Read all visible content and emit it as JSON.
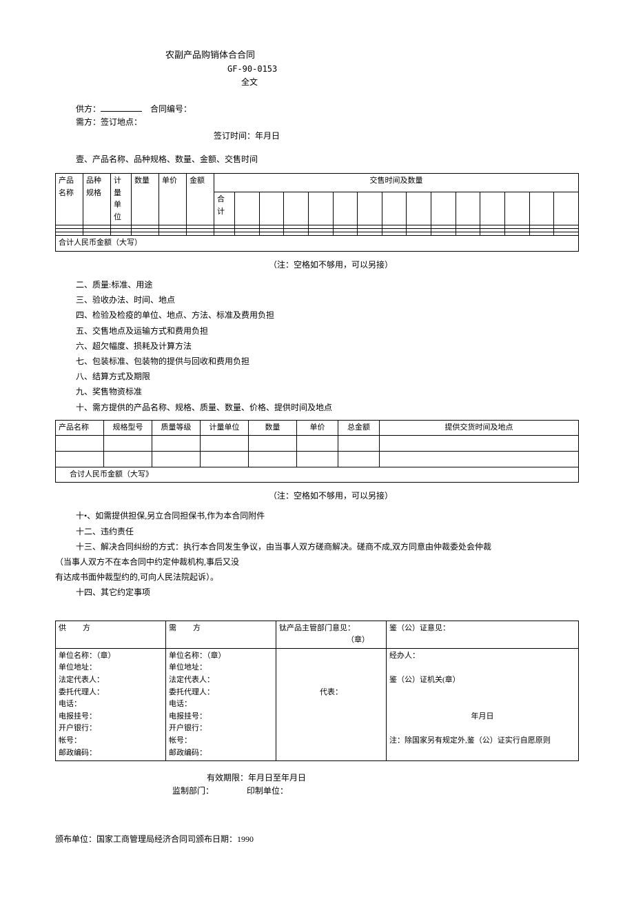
{
  "header": {
    "title": "农副产品购销体合合同",
    "code": "GF-90-0153",
    "fulltext": "全文"
  },
  "parties": {
    "supplier_label": "供方：",
    "contract_no_label": "合同编号：",
    "buyer_label": "需方：",
    "sign_place_label": "签订地点：",
    "sign_time_label": "签订时间：年月日"
  },
  "section1": {
    "title": "壹、产品名称、品种规格、数量、金额、交售时间"
  },
  "table1": {
    "h1": "产品名称",
    "h2": "品种规格",
    "h3": "计量单位",
    "h4": "数量",
    "h5": "单价",
    "h6": "金额",
    "h7": "交售时间及数量",
    "h8": "合计",
    "total": "合计人民币金额（大写）"
  },
  "note": "（注：空格如不够用，可以另接）",
  "terms": {
    "t2": "二、质量:标准、用途",
    "t3": "三、验收办法、时间、地点",
    "t4": "四、检验及检疫的单位、地点、方法、标准及费用负担",
    "t5": "五、交售地点及运输方式和费用负担",
    "t6": "六、超欠幅度、损耗及计算方法",
    "t7": "七、包装标准、包装物的提供与回收和费用负担",
    "t8": "八、结算方式及期限",
    "t9": "九、奖售物资标准",
    "t10": "十、需方提供的产品名称、规格、质量、数量、价格、提供时间及地点"
  },
  "table2": {
    "h1": "产品名称",
    "h2": "规格型号",
    "h3": "质量等级",
    "h4": "计量单位",
    "h5": "数量",
    "h6": "单价",
    "h7": "总金额",
    "h8": "提供交货时间及地点",
    "total": "合讨人民币金额（大写》"
  },
  "terms2": {
    "t11": "十•、如需提供担保,另立合同担保书,作为本合同附件",
    "t12": "十二、违约责任",
    "t13a": "十三、解决合同纠纷的方式：执行本合同发生争议，由当事人双方磋商解决。磋商不成,双方同意由仲裁委处会仲裁",
    "t13b": "（当事人双方不在本合同中约定仲裁机构,事后又没",
    "t13c": "有达成书面仲裁型约的,可向人民法院起诉）。",
    "t14": "十四、其它约定事项"
  },
  "sig": {
    "supplier_hdr": "供方",
    "buyer_hdr": "需方",
    "dept_hdr": "钛产品主管部门意见：",
    "notary_hdr": "鉴（公）证意见：",
    "seal": "（章）",
    "unit_name": "单位名称：（章）",
    "unit_addr": "单位地址：",
    "legal_rep": "法定代表人：",
    "agent": "委托代理人：",
    "phone": "电话：",
    "telegram": "电报挂号：",
    "bank": "开户银行：",
    "account": "帐号：",
    "postal": "邮政编码：",
    "handler": "经办人：",
    "notary_org": "鉴（公）证机关(章）",
    "representative": "代表：",
    "date": "年月日",
    "note": "注：除国家另有规定外,鉴（公）证实行自愿原则"
  },
  "footer": {
    "validity": "有效期限：年月日至年月日",
    "supervise": "监制部门：",
    "print": "印制单位：",
    "publisher": "颁布单位：国家工商管理局经济合同司颁布日期：1990"
  }
}
